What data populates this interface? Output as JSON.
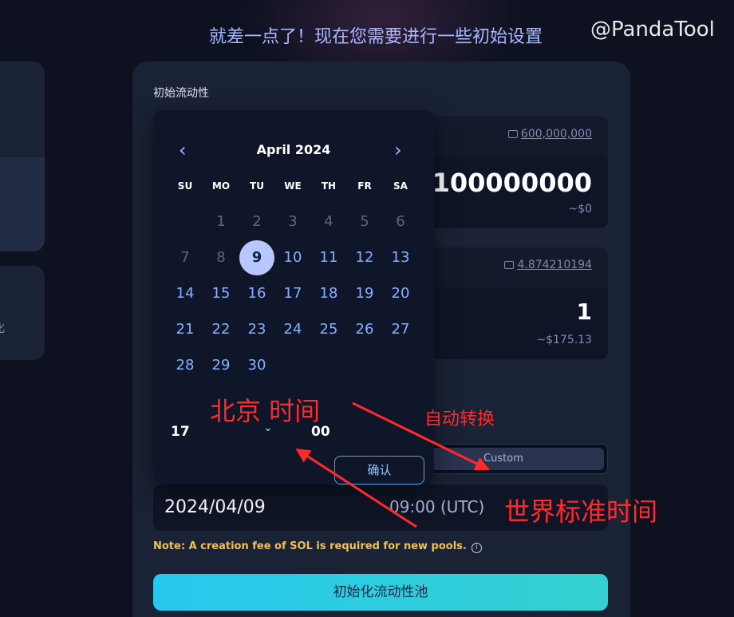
{
  "header": {
    "title": "就差一点了！现在您需要进行一些初始设置"
  },
  "watermark": "@PandaTool",
  "left_partial": {
    "char": "化"
  },
  "card": {
    "label": "初始流动性"
  },
  "token_box": {
    "balance": "600,000,000",
    "amount": "100000000",
    "usd": "~$0"
  },
  "sol_box": {
    "balance": "4.874210194",
    "amount": "1",
    "usd": "~$175.13"
  },
  "custom_button": {
    "label": "Custom"
  },
  "date_field": {
    "date": "2024/04/09",
    "time": "09:00 (UTC)"
  },
  "note": "Note: A creation fee of  SOL is required for new pools.",
  "init_button": {
    "label": "初始化流动性池"
  },
  "calendar": {
    "title": "April 2024",
    "weekdays": [
      "SU",
      "MO",
      "TU",
      "WE",
      "TH",
      "FR",
      "SA"
    ],
    "days": [
      [
        "",
        "1",
        "2",
        "3",
        "4",
        "5",
        "6"
      ],
      [
        "7",
        "8",
        "9",
        "10",
        "11",
        "12",
        "13"
      ],
      [
        "14",
        "15",
        "16",
        "17",
        "18",
        "19",
        "20"
      ],
      [
        "21",
        "22",
        "23",
        "24",
        "25",
        "26",
        "27"
      ],
      [
        "28",
        "29",
        "30",
        "",
        "",
        "",
        ""
      ]
    ],
    "selected_day": "9",
    "hour": "17",
    "minute": "00",
    "confirm_label": "确认"
  },
  "annotations": {
    "beijing": "北京 时间",
    "auto_convert": "自动转换",
    "utc": "世界标准时间",
    "color": "#ff2a2a"
  }
}
